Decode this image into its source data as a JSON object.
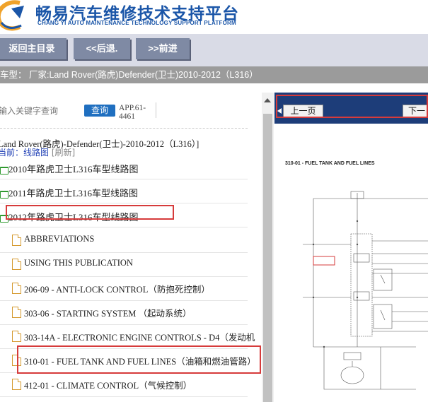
{
  "header": {
    "title_cn": "畅易汽车维修技术支持平台",
    "title_en": "CHANG YI AUTO MAINTENANCE TECHNOLOGY SUPPORT PLATFORM",
    "logo_icon": "changyi-logo-icon",
    "brand_color": "#1b56a8"
  },
  "nav": {
    "home_label": "返回主目录",
    "back_label": "<<后退.",
    "forward_label": ">>前进"
  },
  "model_bar": {
    "text": "车型：   厂家:Land Rover(路虎)Defender(卫士)2010-2012（L316）"
  },
  "search": {
    "placeholder": "输入关键字查询",
    "button_label": "查询",
    "app_code_line1": "APP.61-",
    "app_code_line2": "4461"
  },
  "breadcrumb": {
    "path": "Land Rover(路虎)-Defender(卫士)-2010-2012（L316）]",
    "current_prefix": "当前：线路图",
    "refresh_label": "[刷新]"
  },
  "tree": {
    "folders": [
      {
        "label": "2010年路虎卫士L316车型线路图"
      },
      {
        "label": "2011年路虎卫士L316车型线路图"
      },
      {
        "label": "2012年路虎卫士L316车型线路图"
      }
    ],
    "documents": [
      {
        "label": "ABBREVIATIONS"
      },
      {
        "label": "USING THIS PUBLICATION"
      },
      {
        "label": "206-09 - ANTI-LOCK CONTROL（防抱死控制）"
      },
      {
        "label": "303-06 - STARTING SYSTEM （起动系统）"
      },
      {
        "label": "303-14A - ELECTRONIC ENGINE CONTROLS - D4（发动机"
      },
      {
        "label": "310-01 - FUEL TANK AND FUEL LINES（油箱和燃油管路）"
      },
      {
        "label": "412-01 - CLIMATE CONTROL（气候控制）"
      }
    ]
  },
  "viewer": {
    "prev_label": "上一页",
    "next_label": "下一",
    "diagram_title": "310-01 - FUEL TANK AND FUEL LINES",
    "highlight_color": "#d63b3b"
  }
}
